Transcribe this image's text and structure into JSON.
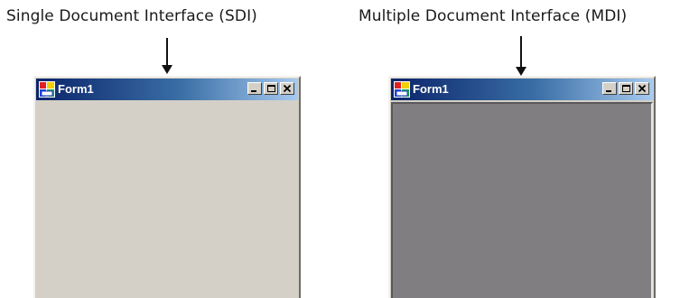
{
  "captions": {
    "sdi": "Single Document Interface (SDI)",
    "mdi": "Multiple Document Interface (MDI)"
  },
  "windows": {
    "sdi": {
      "title": "Form1",
      "icon": "form-app-icon"
    },
    "mdi": {
      "title": "Form1",
      "icon": "form-app-icon"
    }
  },
  "title_buttons": [
    "minimize-icon",
    "maximize-icon",
    "close-icon"
  ],
  "colors": {
    "title_start": "#0a246a",
    "title_end": "#a6caf0",
    "face": "#d4d0c8",
    "mdi_client": "#807e80"
  }
}
